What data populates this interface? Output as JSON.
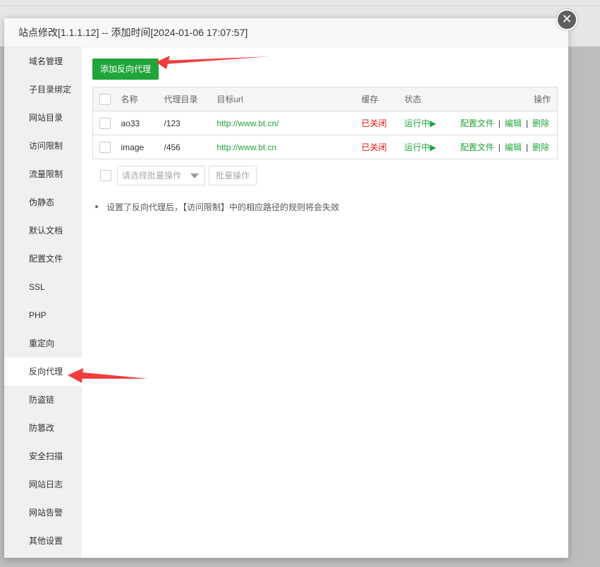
{
  "dialog": {
    "title": "站点修改[1.1.1.12] -- 添加时间[2024-01-06 17:07:57]",
    "close_label": "✕"
  },
  "sidebar": {
    "items": [
      {
        "label": "域名管理"
      },
      {
        "label": "子目录绑定"
      },
      {
        "label": "网站目录"
      },
      {
        "label": "访问限制"
      },
      {
        "label": "流量限制"
      },
      {
        "label": "伪静态"
      },
      {
        "label": "默认文档"
      },
      {
        "label": "配置文件"
      },
      {
        "label": "SSL"
      },
      {
        "label": "PHP"
      },
      {
        "label": "重定向"
      },
      {
        "label": "反向代理",
        "active": true
      },
      {
        "label": "防盗链"
      },
      {
        "label": "防篡改"
      },
      {
        "label": "安全扫描"
      },
      {
        "label": "网站日志"
      },
      {
        "label": "网站告警"
      },
      {
        "label": "其他设置"
      }
    ]
  },
  "main": {
    "add_button": "添加反向代理",
    "table": {
      "headers": {
        "name": "名称",
        "proxy_dir": "代理目录",
        "target_url": "目标url",
        "cache": "缓存",
        "status": "状态",
        "actions": "操作"
      },
      "rows": [
        {
          "name": "ao33",
          "proxy_dir": "/123",
          "target_url": "http://www.bt.cn/",
          "cache": "已关闭",
          "status": "运行中▶",
          "config": "配置文件",
          "edit": "编辑",
          "delete": "删除"
        },
        {
          "name": "image",
          "proxy_dir": "/456",
          "target_url": "http://www.bt.cn",
          "cache": "已关闭",
          "status": "运行中▶",
          "config": "配置文件",
          "edit": "编辑",
          "delete": "删除"
        }
      ],
      "separator": "|"
    },
    "batch": {
      "select_placeholder": "请选择批量操作",
      "button": "批量操作"
    },
    "tips": [
      "设置了反向代理后，【访问限制】中的相应路径的规则将会失效"
    ]
  },
  "colors": {
    "accent_green": "#20a53a",
    "status_red": "#ef0808",
    "annotation_red": "#f03c3c"
  }
}
